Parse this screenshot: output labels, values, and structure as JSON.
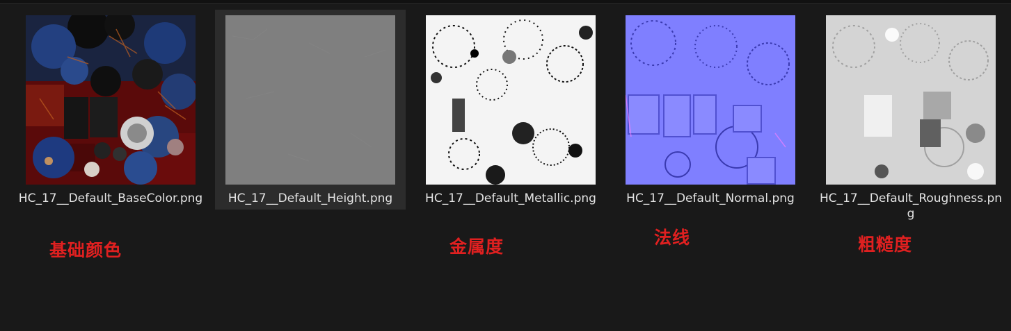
{
  "files": [
    {
      "name": "HC_17__Default_BaseColor.png",
      "preview": "basecolor-texture"
    },
    {
      "name": "HC_17__Default_Height.png",
      "preview": "height-texture",
      "selected": true
    },
    {
      "name": "HC_17__Default_Metallic.png",
      "preview": "metallic-texture"
    },
    {
      "name": "HC_17__Default_Normal.png",
      "preview": "normal-texture"
    },
    {
      "name": "HC_17__Default_Roughness.png",
      "preview": "roughness-texture"
    }
  ],
  "annotations": {
    "basecolor": "基础颜色",
    "metallic": "金属度",
    "normal": "法线",
    "roughness": "粗糙度"
  },
  "colors": {
    "background": "#191919",
    "selected_bg": "#2c2c2c",
    "annotation": "#e02020"
  }
}
